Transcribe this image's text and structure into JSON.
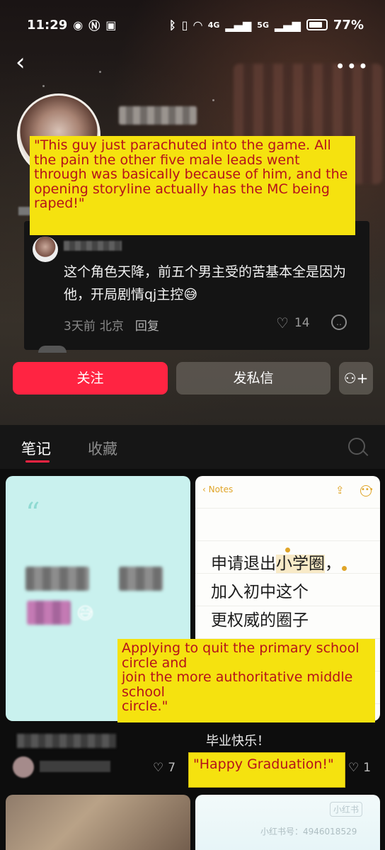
{
  "status_bar": {
    "time": "11:29",
    "network_1": "4G",
    "network_2": "5G",
    "battery": "77%"
  },
  "actions": {
    "follow_label": "关注",
    "message_label": "发私信"
  },
  "comment": {
    "text": "这个角色天降，前五个男主受的苦基本全是因为他，开局剧情qj主控😅",
    "time": "3天前",
    "location": "北京",
    "reply_label": "回复",
    "likes": "14"
  },
  "captions": {
    "comment_translation": "\"This guy just parachuted into the game. All the pain the other five male leads went through was basically because of him, and the opening storyline actually has the MC being raped!\"",
    "note_translation": "Applying to quit the primary school circle and\njoin the more authoritative middle school\ncircle.\"",
    "title_translation": "\"Happy Graduation!\""
  },
  "tabs": {
    "notes": "笔记",
    "collections": "收藏"
  },
  "feed": {
    "left_card": {
      "quote_mark": "“",
      "likes": "7"
    },
    "right_card": {
      "notes_back": "‹ Notes",
      "line_1_prefix": "申请退出",
      "line_1_highlight": "小学圈",
      "line_1_suffix": "，",
      "line_2": "加入初中这个",
      "line_3": "更权威的圈子",
      "title": "毕业快乐！",
      "likes": "1"
    },
    "bottom_right": {
      "logo": "小红书",
      "watermark_id": "小红书号：4946018529"
    }
  },
  "colors": {
    "brand_red": "#ff2442",
    "caption_yellow": "#f5e20f",
    "caption_text": "#b5121b",
    "notes_accent": "#e0a528"
  }
}
